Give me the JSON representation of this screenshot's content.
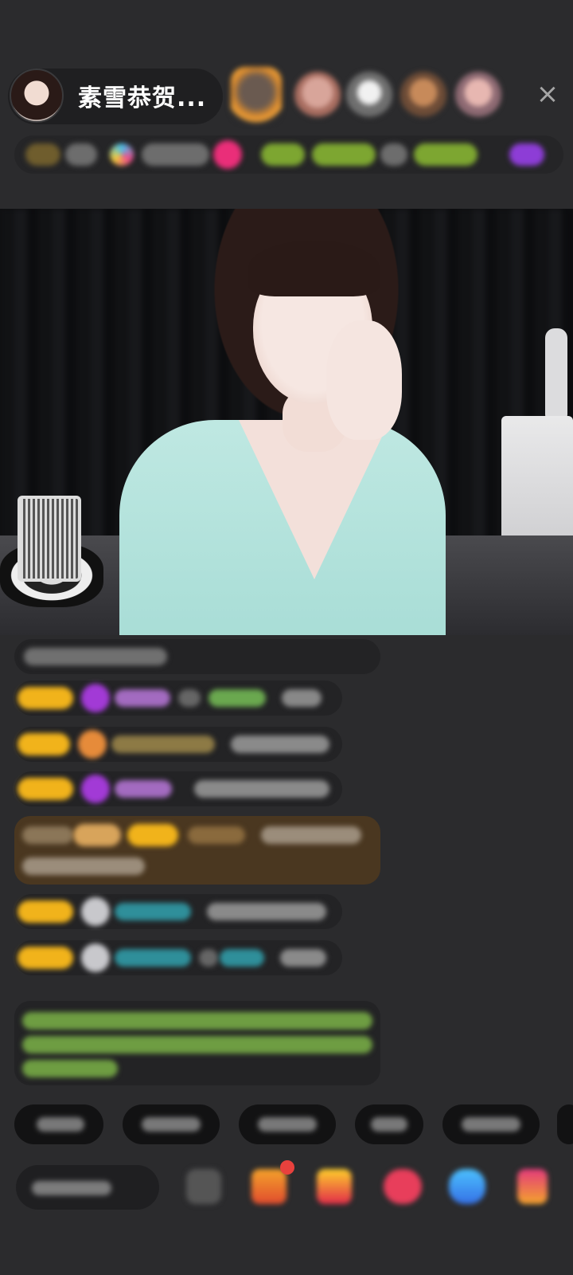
{
  "header": {
    "host_name": "素雪恭贺..."
  },
  "colors": {
    "background": "#2b2b2d",
    "chat_gold_badge": "#f1b31b",
    "chat_purple_icon": "#a23ad6",
    "chat_orange_icon": "#e68b3a",
    "chat_brown_row": "#4a3720",
    "chat_green_text": "#7cc34f",
    "gift_red_dot": "#e8413d"
  },
  "icons": {
    "close": "×"
  }
}
